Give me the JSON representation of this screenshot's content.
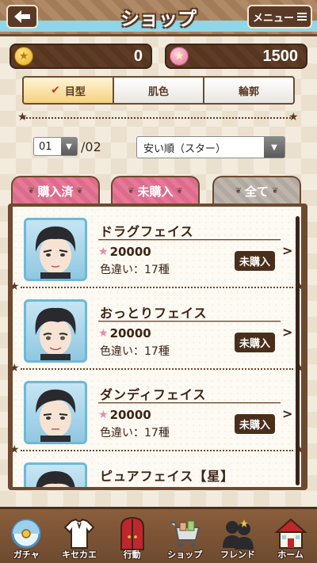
{
  "header": {
    "title": "ショップ",
    "back_icon": "arrow-left-icon",
    "menu_label": "メニュー",
    "menu_icon": "hamburger-icon",
    "band_color": "#8fd6e8"
  },
  "currency": {
    "coin": {
      "icon": "coin-icon",
      "value": "0"
    },
    "star": {
      "icon": "star-icon",
      "value": "1500"
    }
  },
  "category_tabs": [
    {
      "label": "目型",
      "selected": true
    },
    {
      "label": "肌色",
      "selected": false
    },
    {
      "label": "輪郭",
      "selected": false
    }
  ],
  "pager": {
    "current": "01",
    "total": "/02"
  },
  "sort": {
    "selected": "安い順（スター）"
  },
  "filter_tabs": [
    {
      "label": "購入済",
      "color": "#e67898"
    },
    {
      "label": "未購入",
      "color": "#e67898"
    },
    {
      "label": "全て",
      "color": "#bdb6ae"
    }
  ],
  "items": [
    {
      "name": "ドラグフェイス",
      "price": "20000",
      "variants": "色違い：17種",
      "status": "未購入"
    },
    {
      "name": "おっとりフェイス",
      "price": "20000",
      "variants": "色違い：17種",
      "status": "未購入"
    },
    {
      "name": "ダンディフェイス",
      "price": "20000",
      "variants": "色違い：17種",
      "status": "未購入"
    },
    {
      "name": "ピュアフェイス【星】"
    }
  ],
  "bottom_nav": [
    {
      "label": "ガチャ",
      "icon": "gacha-capsule-icon"
    },
    {
      "label": "キセカエ",
      "icon": "dress-up-shirt-icon"
    },
    {
      "label": "行動",
      "icon": "door-icon"
    },
    {
      "label": "ショップ",
      "icon": "shopping-cart-icon"
    },
    {
      "label": "フレンド",
      "icon": "friends-icon"
    },
    {
      "label": "ホーム",
      "icon": "house-icon"
    }
  ]
}
